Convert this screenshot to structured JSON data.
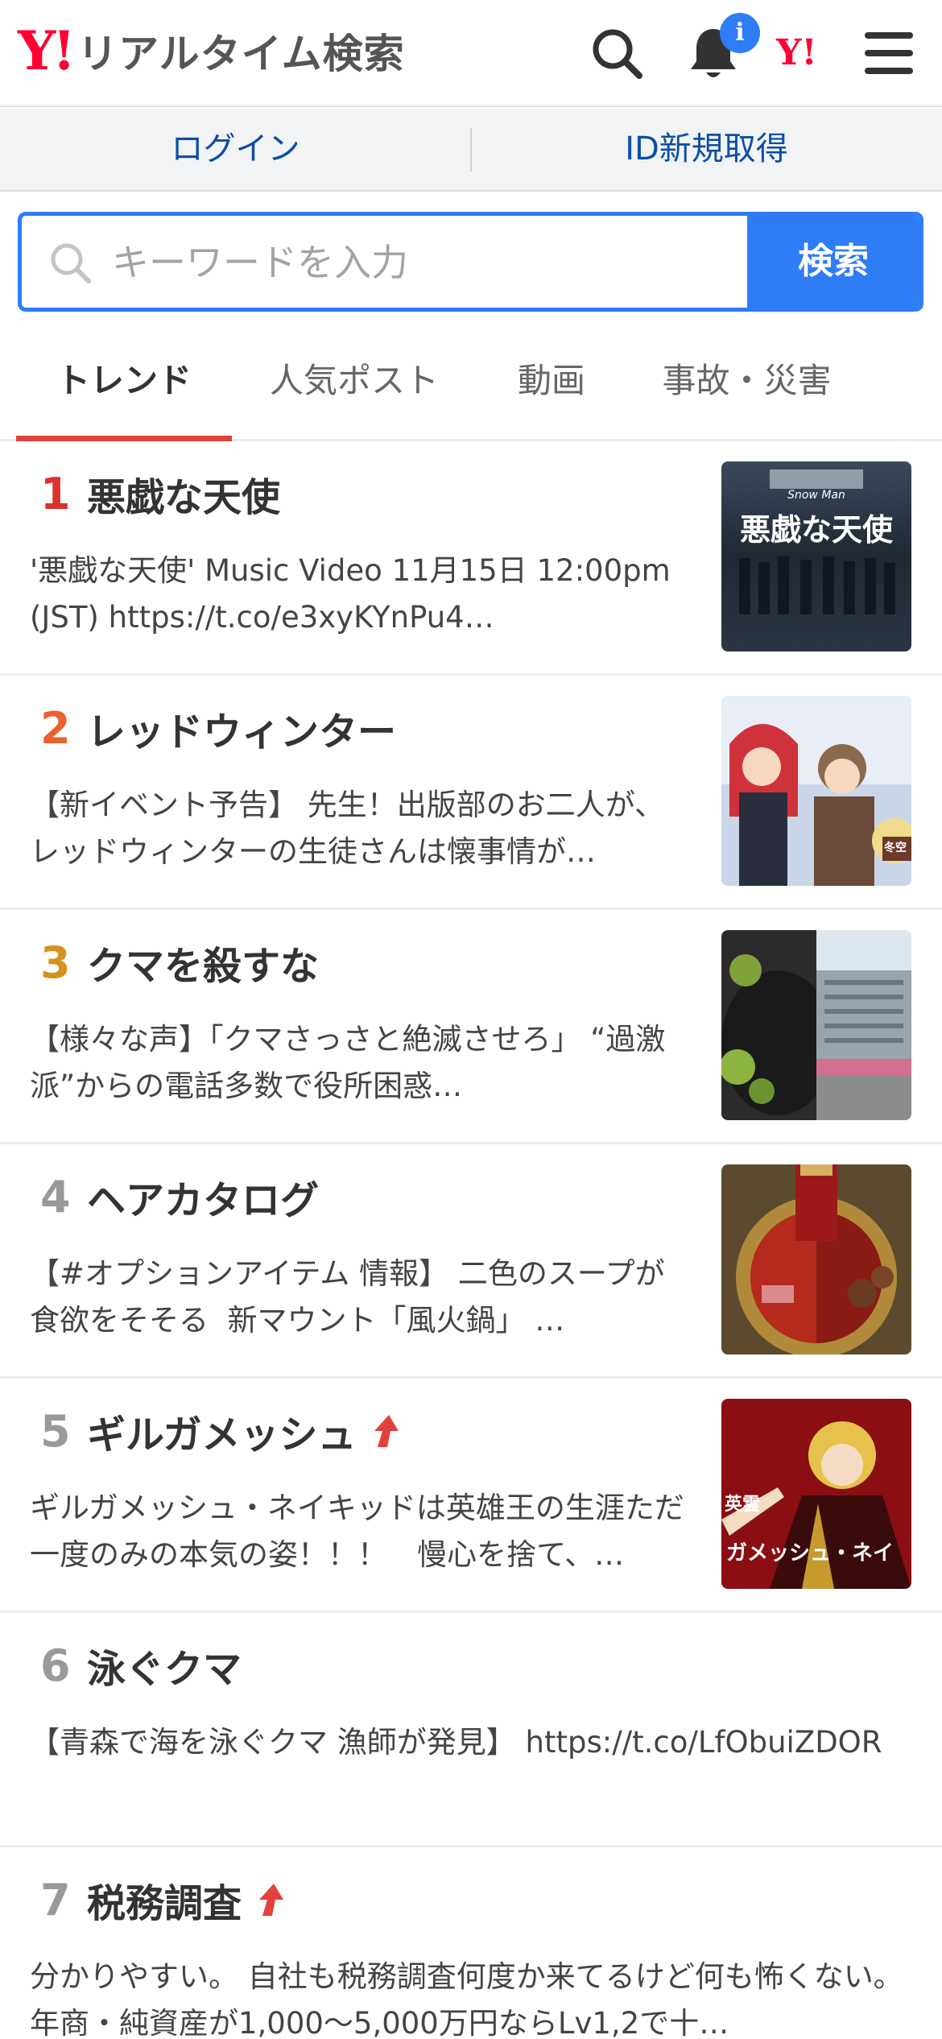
{
  "header": {
    "logo_mark": "Y!",
    "logo_text": "リアルタイム検索",
    "notification_badge": "i",
    "yahoo_mark": "Y!",
    "icons": [
      "search-icon",
      "bell-icon",
      "yahoo-logo-icon",
      "menu-icon"
    ]
  },
  "login_bar": {
    "login": "ログイン",
    "register": "ID新規取得"
  },
  "search": {
    "placeholder": "キーワードを入力",
    "button": "検索"
  },
  "tabs": [
    {
      "label": "トレンド",
      "active": true
    },
    {
      "label": "人気ポスト",
      "active": false
    },
    {
      "label": "動画",
      "active": false
    },
    {
      "label": "事故・災害",
      "active": false
    }
  ],
  "colors": {
    "accent": "#2e7cf6",
    "brand": "#ff0033",
    "active_tab": "#e0423b",
    "rank1": "#d9342b",
    "rank2": "#e8632d",
    "rank3": "#d4931f",
    "rank_other": "#999999",
    "trend_up": "#e0423b"
  },
  "trends": [
    {
      "rank": "1",
      "title": "悪戯な天使",
      "desc": "'悪戯な天使' Music Video󠀠 󠀠11月15日 12:00pm(JST) https://t.co/e3xyKYnPu4…",
      "has_image": true,
      "rising": false,
      "thumb_text": "Snow Man 悪戯な天使"
    },
    {
      "rank": "2",
      "title": "レッドウィンター",
      "desc": "【新イベント予告】 先生！出版部のお二人が、レッドウィンターの生徒さんは懐事情が…",
      "has_image": true,
      "rising": false,
      "thumb_text": "冬空"
    },
    {
      "rank": "3",
      "title": "クマを殺すな",
      "desc": "【様々な声】「クマさっさと絶滅させろ」 “過激派”からの電話多数で役所困惑…",
      "has_image": true,
      "rising": false,
      "thumb_text": ""
    },
    {
      "rank": "4",
      "title": "ヘアカタログ",
      "desc": "【#オプションアイテム 情報】 󠀠二色のスープが食欲をそそる󠀠 󠀠 新マウント「風火鍋」󠀠 …",
      "has_image": true,
      "rising": false,
      "thumb_text": ""
    },
    {
      "rank": "5",
      "title": "ギルガメッシュ",
      "desc": "ギルガメッシュ・ネイキッドは英雄王の生涯ただ一度のみの本気の姿！！！　慢心を捨て、…",
      "has_image": true,
      "rising": true,
      "thumb_text": "英霊 ガメッシュ・ネイ"
    },
    {
      "rank": "6",
      "title": "泳ぐクマ",
      "desc": "【青森で海を泳ぐクマ 漁師が発見】 https://t.co/LfObuiZDOR",
      "has_image": false,
      "rising": false,
      "thumb_text": ""
    },
    {
      "rank": "7",
      "title": "税務調査",
      "desc": "分かりやすい。 自社も税務調査何度か来てるけど何も怖くない。 年商・純資産が1,000〜5,000万円ならLv1,2で十…",
      "has_image": false,
      "rising": true,
      "thumb_text": ""
    }
  ]
}
